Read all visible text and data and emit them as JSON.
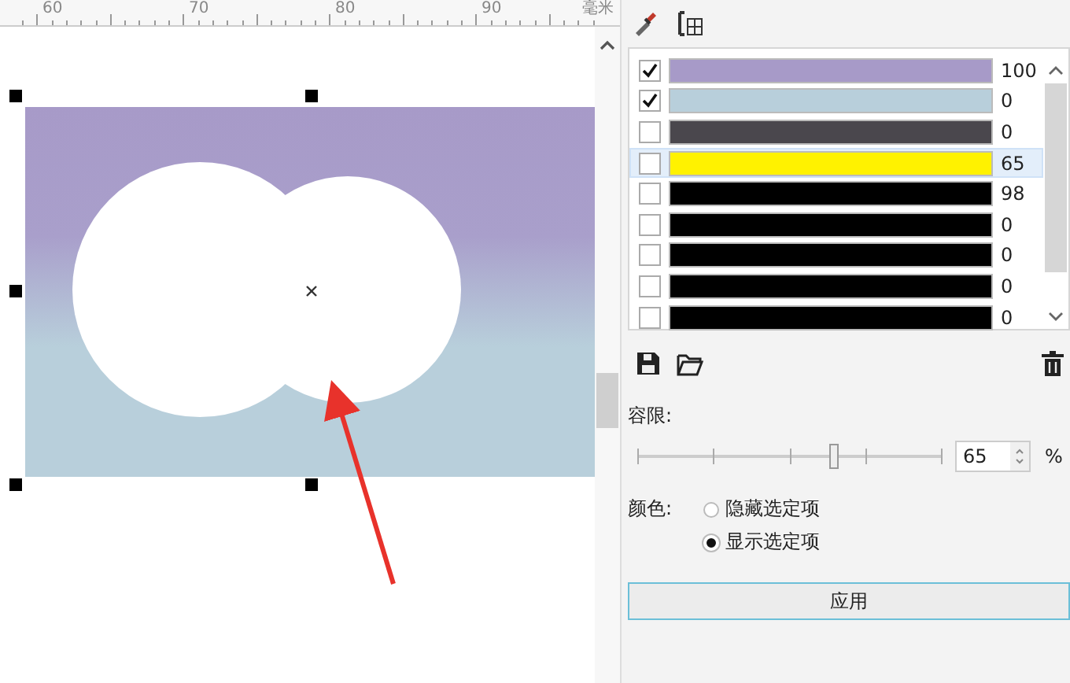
{
  "ruler": {
    "labels": [
      "60",
      "70",
      "80",
      "90"
    ],
    "unit": "毫米"
  },
  "colors": [
    {
      "checked": true,
      "selected": false,
      "color": "#a79ac8",
      "value": "100"
    },
    {
      "checked": true,
      "selected": false,
      "color": "#b8cfdb",
      "value": "0"
    },
    {
      "checked": false,
      "selected": false,
      "color": "#4a474d",
      "value": "0"
    },
    {
      "checked": false,
      "selected": true,
      "color": "#fff200",
      "value": "65"
    },
    {
      "checked": false,
      "selected": false,
      "color": "#000000",
      "value": "98"
    },
    {
      "checked": false,
      "selected": false,
      "color": "#000000",
      "value": "0"
    },
    {
      "checked": false,
      "selected": false,
      "color": "#000000",
      "value": "0"
    },
    {
      "checked": false,
      "selected": false,
      "color": "#000000",
      "value": "0"
    },
    {
      "checked": false,
      "selected": false,
      "color": "#000000",
      "value": "0"
    }
  ],
  "tolerance": {
    "label": "容限:",
    "level": 0.65,
    "value": "65",
    "unit": "%"
  },
  "color_mode": {
    "label": "颜色:",
    "options": [
      {
        "label": "隐藏选定项",
        "selected": false
      },
      {
        "label": "显示选定项",
        "selected": true
      }
    ]
  },
  "apply_button": "应用"
}
